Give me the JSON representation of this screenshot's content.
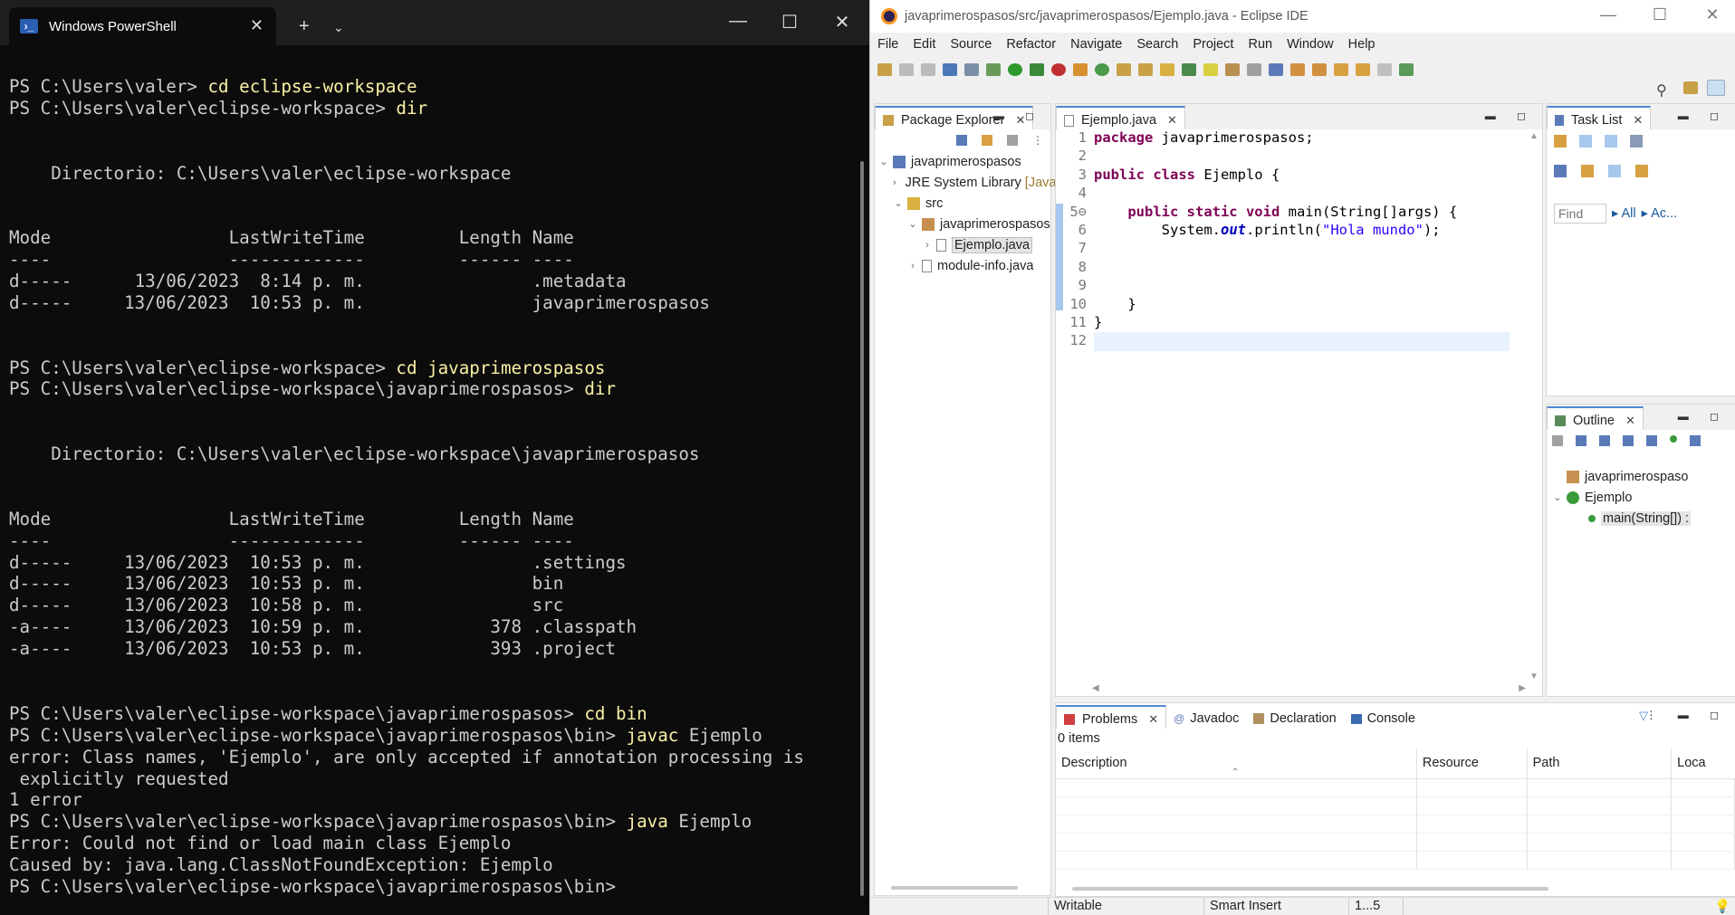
{
  "powershell": {
    "tab_title": "Windows PowerShell",
    "lines": [
      {
        "prompt": "PS C:\\Users\\valer> ",
        "cmd": "cd eclipse-workspace"
      },
      {
        "prompt": "PS C:\\Users\\valer\\eclipse-workspace> ",
        "cmd": "dir"
      },
      {
        "text": ""
      },
      {
        "text": ""
      },
      {
        "text": "    Directorio: C:\\Users\\valer\\eclipse-workspace"
      },
      {
        "text": ""
      },
      {
        "text": ""
      },
      {
        "text": "Mode                 LastWriteTime         Length Name"
      },
      {
        "text": "----                 -------------         ------ ----"
      },
      {
        "text": "d-----      13/06/2023  8:14 p. m.                .metadata"
      },
      {
        "text": "d-----     13/06/2023  10:53 p. m.                javaprimerospasos"
      },
      {
        "text": ""
      },
      {
        "text": ""
      },
      {
        "prompt": "PS C:\\Users\\valer\\eclipse-workspace> ",
        "cmd": "cd javaprimerospasos"
      },
      {
        "prompt": "PS C:\\Users\\valer\\eclipse-workspace\\javaprimerospasos> ",
        "cmd": "dir"
      },
      {
        "text": ""
      },
      {
        "text": ""
      },
      {
        "text": "    Directorio: C:\\Users\\valer\\eclipse-workspace\\javaprimerospasos"
      },
      {
        "text": ""
      },
      {
        "text": ""
      },
      {
        "text": "Mode                 LastWriteTime         Length Name"
      },
      {
        "text": "----                 -------------         ------ ----"
      },
      {
        "text": "d-----     13/06/2023  10:53 p. m.                .settings"
      },
      {
        "text": "d-----     13/06/2023  10:53 p. m.                bin"
      },
      {
        "text": "d-----     13/06/2023  10:58 p. m.                src"
      },
      {
        "text": "-a----     13/06/2023  10:59 p. m.            378 .classpath"
      },
      {
        "text": "-a----     13/06/2023  10:53 p. m.            393 .project"
      },
      {
        "text": ""
      },
      {
        "text": ""
      },
      {
        "prompt": "PS C:\\Users\\valer\\eclipse-workspace\\javaprimerospasos> ",
        "cmd": "cd bin"
      },
      {
        "prompt": "PS C:\\Users\\valer\\eclipse-workspace\\javaprimerospasos\\bin> ",
        "cmd": "javac",
        "rest": " Ejemplo"
      },
      {
        "text": "error: Class names, 'Ejemplo', are only accepted if annotation processing is"
      },
      {
        "text": " explicitly requested"
      },
      {
        "text": "1 error"
      },
      {
        "prompt": "PS C:\\Users\\valer\\eclipse-workspace\\javaprimerospasos\\bin> ",
        "cmd": "java",
        "rest": " Ejemplo"
      },
      {
        "text": "Error: Could not find or load main class Ejemplo"
      },
      {
        "text": "Caused by: java.lang.ClassNotFoundException: Ejemplo"
      },
      {
        "prompt": "PS C:\\Users\\valer\\eclipse-workspace\\javaprimerospasos\\bin> ",
        "cmd": ""
      }
    ]
  },
  "eclipse": {
    "title": "javaprimerospasos/src/javaprimerospasos/Ejemplo.java - Eclipse IDE",
    "menu": [
      "File",
      "Edit",
      "Source",
      "Refactor",
      "Navigate",
      "Search",
      "Project",
      "Run",
      "Window",
      "Help"
    ],
    "package_explorer": {
      "tab": "Package Explorer",
      "tree": [
        {
          "label": "javaprimerospasos",
          "indent": 0,
          "twisty": "⌄",
          "icon": "project"
        },
        {
          "label": "JRE System Library",
          "suffix": "[JavaSE",
          "indent": 1,
          "twisty": "›",
          "icon": "library"
        },
        {
          "label": "src",
          "indent": 1,
          "twisty": "⌄",
          "icon": "folder"
        },
        {
          "label": "javaprimerospasos",
          "indent": 2,
          "twisty": "⌄",
          "icon": "package"
        },
        {
          "label": "Ejemplo.java",
          "indent": 3,
          "twisty": "›",
          "icon": "java",
          "selected": true
        },
        {
          "label": "module-info.java",
          "indent": 2,
          "twisty": "›",
          "icon": "java"
        }
      ]
    },
    "editor": {
      "tab": "Ejemplo.java",
      "line_numbers": [
        "1",
        "2",
        "3",
        "4",
        "5⊖",
        "6",
        "7",
        "8",
        "9",
        "10",
        "11",
        "12"
      ]
    },
    "task_list": {
      "tab": "Task List",
      "find_placeholder": "Find",
      "all_label": "All",
      "ac_label": "Ac..."
    },
    "outline": {
      "tab": "Outline",
      "items": [
        {
          "label": "javaprimerospaso",
          "indent": 0
        },
        {
          "label": "Ejemplo",
          "indent": 0,
          "twisty": "⌄"
        },
        {
          "label": "main(String[]) :",
          "indent": 1,
          "selected": true
        }
      ]
    },
    "problems": {
      "tabs": [
        "Problems",
        "Javadoc",
        "Declaration",
        "Console"
      ],
      "count": "0 items",
      "columns": [
        "Description",
        "Resource",
        "Path",
        "Loca"
      ]
    },
    "status": {
      "writable": "Writable",
      "insert": "Smart Insert",
      "position": "1...5"
    }
  }
}
